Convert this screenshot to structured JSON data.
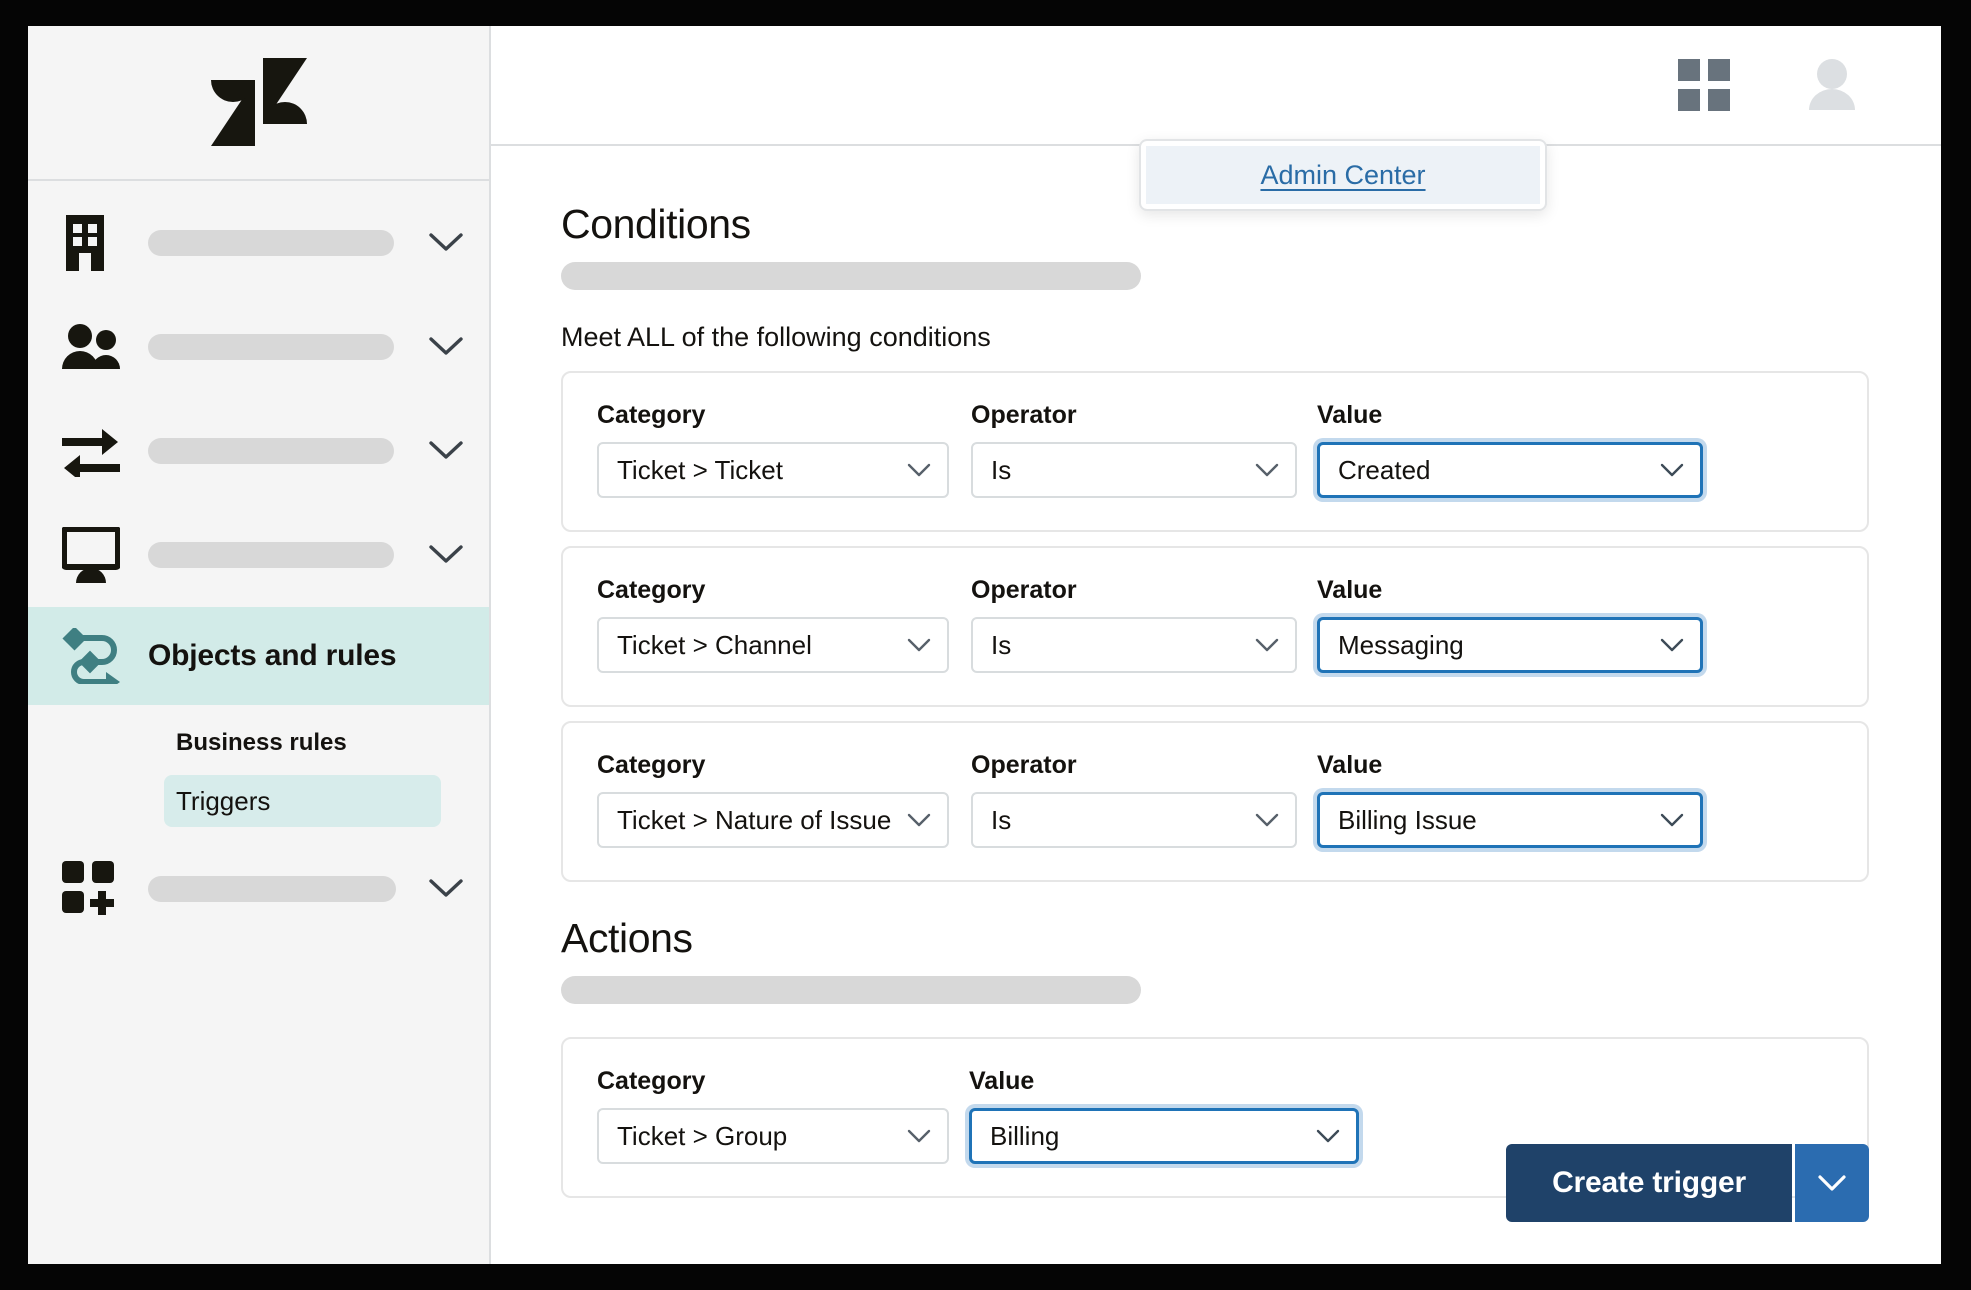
{
  "sidebar": {
    "logo": "zendesk-logo",
    "items": [
      {
        "icon": "building-icon",
        "label": "",
        "placeholder": true,
        "chevron": true
      },
      {
        "icon": "people-icon",
        "label": "",
        "placeholder": true,
        "chevron": true
      },
      {
        "icon": "transfer-arrows-icon",
        "label": "",
        "placeholder": true,
        "chevron": true
      },
      {
        "icon": "monitor-person-icon",
        "label": "",
        "placeholder": true,
        "chevron": true
      }
    ],
    "active_item": {
      "icon": "objects-rules-icon",
      "label": "Objects and rules"
    },
    "sub_group_heading": "Business rules",
    "sub_items": [
      {
        "label": "Triggers",
        "selected": true
      }
    ],
    "bottom_item": {
      "icon": "apps-add-icon",
      "label": "",
      "placeholder": true,
      "chevron": true
    }
  },
  "topbar": {
    "products_icon": "grid-apps-icon",
    "avatar_icon": "user-avatar-icon"
  },
  "admin_menu": {
    "items": [
      {
        "label": "Admin Center",
        "highlighted": true
      }
    ]
  },
  "conditions": {
    "title": "Conditions",
    "subtitle": "Meet ALL of the following conditions",
    "labels": {
      "category": "Category",
      "operator": "Operator",
      "value": "Value"
    },
    "rows": [
      {
        "category": "Ticket > Ticket",
        "operator": "Is",
        "value": "Created",
        "value_focused": true
      },
      {
        "category": "Ticket > Channel",
        "operator": "Is",
        "value": "Messaging",
        "value_focused": true
      },
      {
        "category": "Ticket > Nature of Issue",
        "operator": "Is",
        "value": "Billing Issue",
        "value_focused": true
      }
    ]
  },
  "actions": {
    "title": "Actions",
    "labels": {
      "category": "Category",
      "value": "Value"
    },
    "rows": [
      {
        "category": "Ticket > Group",
        "value": "Billing",
        "value_focused": true
      }
    ]
  },
  "footer": {
    "primary_button": "Create trigger",
    "split_chevron_icon": "chevron-down-icon"
  },
  "colors": {
    "accent_teal": "#3f7f82",
    "active_nav_bg": "#d2ebe8",
    "focus_blue": "#1f73b7",
    "focus_ring": "#c3d9ed",
    "primary_button": "#1f4269",
    "split_button": "#2b6cb0",
    "link_blue": "#2a6ca6",
    "menu_highlight": "#edf2f7",
    "placeholder_gray": "#d8d8d8"
  }
}
